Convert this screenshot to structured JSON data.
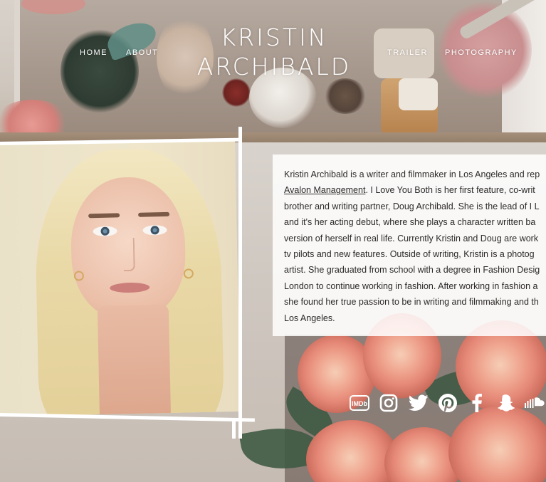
{
  "site": {
    "title_line1": "KRISTIN",
    "title_line2": "ARCHIBALD"
  },
  "nav": {
    "left": [
      {
        "label": "HOME"
      },
      {
        "label": "ABOUT"
      }
    ],
    "right": [
      {
        "label": "TRAILER"
      },
      {
        "label": "PHOTOGRAPHY"
      }
    ]
  },
  "bio": {
    "line1": "Kristin Archibald is a writer and filmmaker in Los Angeles and rep",
    "link_text": "Avalon Management",
    "line2_rest": ".  I Love You Both is her first feature, co-writ",
    "line3": "brother and writing partner, Doug Archibald.  She is the lead of I L",
    "line4": "and it's her acting debut, where she plays a character written ba",
    "line5": "version of herself in real life.  Currently Kristin and Doug are work",
    "line6": "tv pilots and new features.  Outside of writing, Kristin is a photog",
    "line7": "artist.  She graduated from school with a degree in Fashion Desig",
    "line8": "London to continue working in fashion.  After working in fashion a",
    "line9": "she found her true passion to be in writing and filmmaking and th",
    "line10": "Los Angeles."
  },
  "social": {
    "imdb_label": "IMDb",
    "icons": [
      "imdb-icon",
      "instagram-icon",
      "twitter-icon",
      "pinterest-icon",
      "facebook-icon",
      "snapchat-icon",
      "soundcloud-icon"
    ]
  },
  "colors": {
    "nav_text": "#ffffff",
    "bio_panel": "#ffffff",
    "bio_text": "#2d2a28"
  }
}
